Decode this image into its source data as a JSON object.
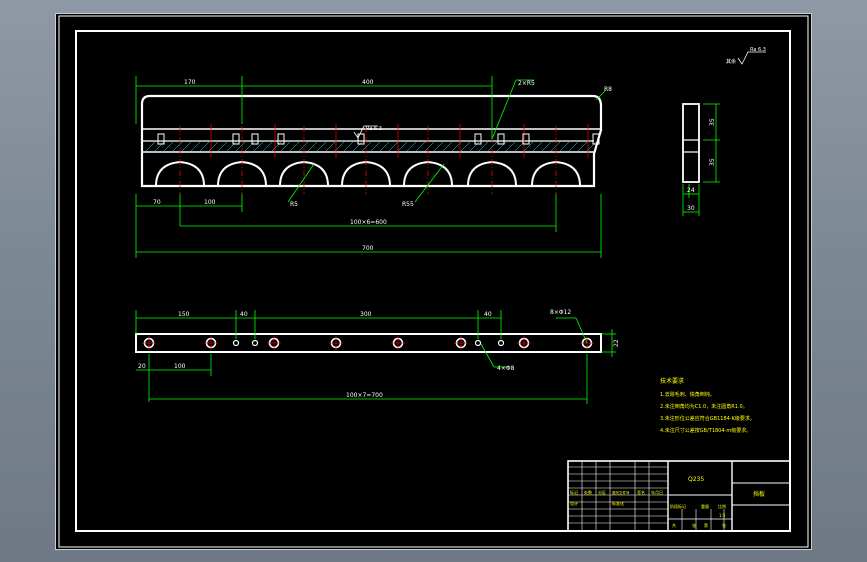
{
  "drawing": {
    "background": "#000000",
    "line_color": "#ffffff",
    "dim_color": "#00ff00",
    "center_color": "#ff0000",
    "hatch_color": "#00ffff",
    "text_color": "#ffff00"
  },
  "front_view": {
    "dims": {
      "left_offset": "170",
      "span_top": "400",
      "radius_callout": "2×R5",
      "end_radius": "R8",
      "bottom_left": "70",
      "bottom_pitch": "100",
      "arch_radius": "R5",
      "arch_radius_big": "R55",
      "pitch_total": "100×6=600",
      "overall": "700",
      "roughness_note": "Ra 6.3"
    }
  },
  "side_view": {
    "dims": {
      "height_top": "35",
      "height_bottom": "35",
      "thick_inner": "24",
      "thick_outer": "30"
    },
    "roughness_corner": "Ra 6.3",
    "roughness_corner_prefix": "其余"
  },
  "plan_view": {
    "dims": {
      "left": "150",
      "small_gap_left": "40",
      "middle": "300",
      "small_gap_right": "40",
      "hole_callout": "8×Φ12",
      "end_offset": "20",
      "first_pitch": "100",
      "small_holes": "4×Φ8",
      "width": "22",
      "pitch_total": "100×7=700"
    }
  },
  "tech_req": {
    "title": "技术要求",
    "items": [
      "1.去除毛刺、锐角倒钝。",
      "2.未注倒角均为C1.0，未注圆角R1.0。",
      "3.未注形位公差应符合GB1184-K级要求。",
      "4.未注尺寸公差按GB/T1804-m级要求。"
    ]
  },
  "title_block": {
    "material": "Q235",
    "part_name": "挡板",
    "scale": "1:5",
    "row_labels": [
      "标记",
      "处数",
      "分区",
      "更改文件号",
      "签名",
      "年月日"
    ],
    "designer": "设计",
    "standard": "标准化",
    "stage_label": "阶段标记",
    "weight": "重量",
    "ratio_label": "比例",
    "sheet": "共",
    "sheet_of": "张",
    "page": "第"
  }
}
